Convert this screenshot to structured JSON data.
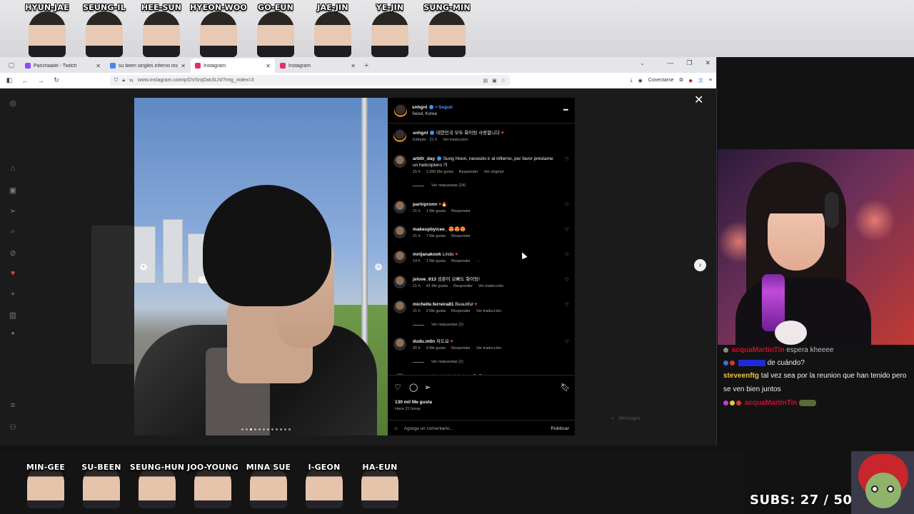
{
  "cast_top": [
    "HYUN-JAE",
    "SEUNG-IL",
    "HEE-SUN",
    "HYEON-WOO",
    "GO-EUN",
    "JAE-JIN",
    "YE-JIN",
    "SUNG-MIN"
  ],
  "cast_bottom": [
    "MIN-GEE",
    "SU-BEEN",
    "SEUNG-HUN",
    "JOO-YOUNG",
    "MINA SUE",
    "I-GEON",
    "HA-EUN"
  ],
  "browser": {
    "tabs": [
      {
        "label": "Panchaalel - Twitch",
        "color": "#9146ff"
      },
      {
        "label": "su been singles inferno instagra",
        "color": "#4285f4"
      },
      {
        "label": "Instagram",
        "color": "#e1306c"
      },
      {
        "label": "Instagram",
        "color": "#e1306c"
      }
    ],
    "active_tab": 2,
    "url": "www.instagram.com/p/DVSrqOxkSLN/?img_index=3",
    "connect_label": "Conectarse"
  },
  "post": {
    "username": "snhgnl",
    "follow_label": "Seguir",
    "location": "Seoul, Korea",
    "caption": {
      "text": "대한민국 모두 화이팅 사랑합니다",
      "emoji": "♥",
      "meta": [
        "Editado · 21 h",
        "Ver traducción"
      ]
    },
    "comments": [
      {
        "user": "arb0r_day",
        "verified": true,
        "text": "Sung Hoon, necesito ir al infierno, por favor préstame un helicóptero 가",
        "emoji": "",
        "meta": [
          "15 h",
          "1,360 Me gusta",
          "Responder",
          "Ver original"
        ],
        "replies": "Ver respuestas (24)"
      },
      {
        "user": "parinpronn",
        "verified": false,
        "text": "",
        "emoji": "♥🔥",
        "meta": [
          "21 h",
          "1 Me gusta",
          "Responder"
        ],
        "replies": ""
      },
      {
        "user": "makeupbyicee_",
        "verified": false,
        "text": "",
        "emoji": "😍😍😍",
        "meta": [
          "21 h",
          "7 Me gusta",
          "Responder"
        ],
        "replies": ""
      },
      {
        "user": "mnijanakook",
        "verified": false,
        "text": "Lindo",
        "emoji": "♥",
        "meta": [
          "14 h",
          "1 Me gusta",
          "Responder",
          "···"
        ],
        "replies": ""
      },
      {
        "user": "jslove_613",
        "verified": false,
        "text": "성훈이 오빠도 화이팅!",
        "emoji": "",
        "meta": [
          "21 h",
          "41 Me gusta",
          "Responder",
          "Ver traducción"
        ],
        "replies": ""
      },
      {
        "user": "michelle.ferreira81",
        "verified": false,
        "text": "Beautiful",
        "emoji": "♥",
        "meta": [
          "21 h",
          "2 Me gusta",
          "Responder",
          "Ver traducción"
        ],
        "replies": "Ver respuestas (2)"
      },
      {
        "user": "dudu.m0n",
        "verified": false,
        "text": "저도요",
        "emoji": "♥",
        "meta": [
          "20 h",
          "9 Me gusta",
          "Responder",
          "Ver traducción"
        ],
        "replies": "Ver respuestas (1)"
      },
      {
        "user": "_d.vaah",
        "verified": false,
        "text": "왜 그렇게 귀여워요?",
        "emoji": "😭😭♥",
        "meta": [],
        "replies": ""
      }
    ],
    "likes": "130 mil Me gusta",
    "posted": "Hace 21 horas",
    "comment_placeholder": "Agrega un comentario...",
    "publish_label": "Publicar",
    "messages_label": "Mensajes"
  },
  "chat": [
    {
      "user": "acquaMartinTin",
      "text": "espera kheeee",
      "color": "#c8102e"
    },
    {
      "user": "",
      "text": "de cuándo?",
      "color": "#1e2bd6"
    },
    {
      "user": "steveenftg",
      "text": "tal vez sea por la reunion que han tenido pero se ven bien juntos",
      "color": "#e8c547"
    },
    {
      "user": "acquaMartinTin",
      "text": "",
      "color": "#c8102e"
    }
  ],
  "subs_label": "SUBS: 27 / 50"
}
